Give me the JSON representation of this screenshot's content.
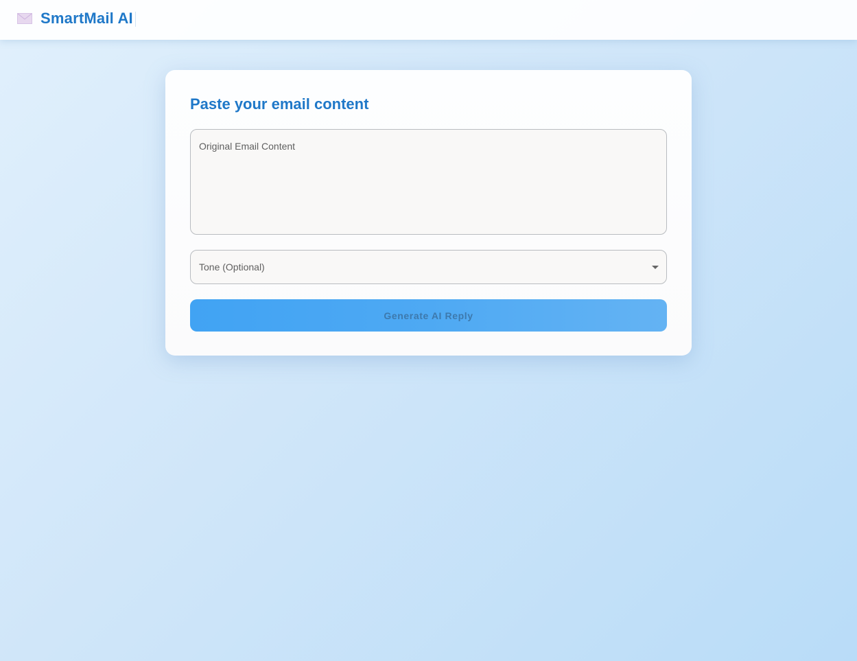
{
  "header": {
    "logo_icon": "envelope-icon",
    "brand": "SmartMail AI"
  },
  "card": {
    "title": "Paste your email content",
    "email_input": {
      "placeholder": "Original Email Content",
      "value": ""
    },
    "tone_select": {
      "label": "Tone (Optional)",
      "icon": "dropdown-arrow-icon"
    },
    "generate_button": {
      "label": "Generate AI Reply"
    }
  },
  "colors": {
    "brand": "#1f78c8",
    "button": "#4ea9f3",
    "button_text": "#3d79ad",
    "background": "#d0e6f9"
  }
}
